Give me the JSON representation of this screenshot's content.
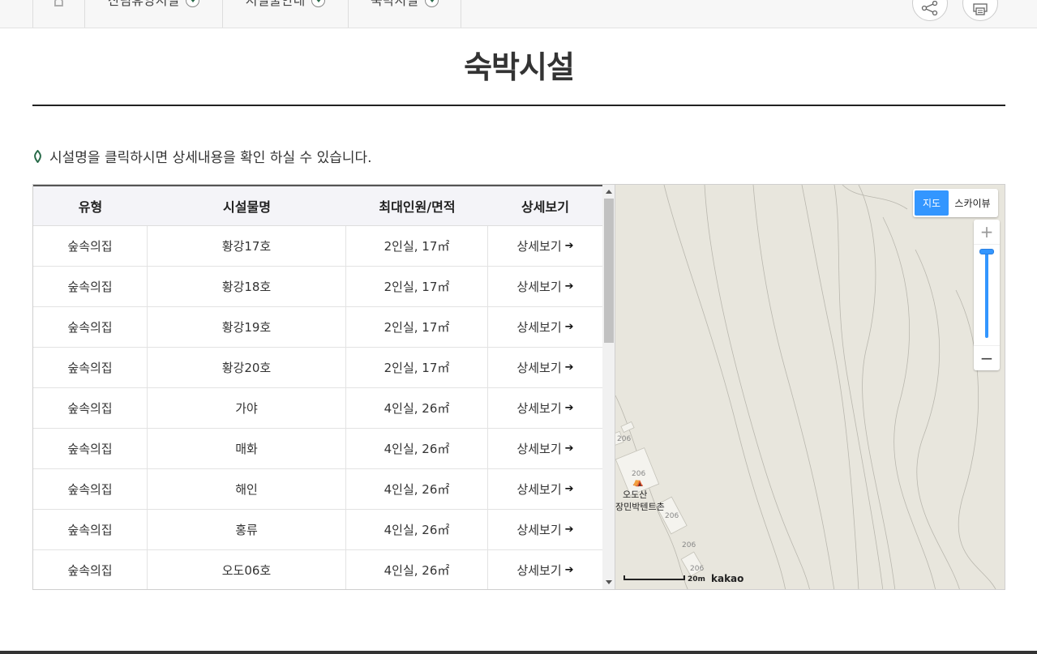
{
  "nav": {
    "items": [
      {
        "label": "산림휴양시설"
      },
      {
        "label": "시설물안내"
      },
      {
        "label": "숙박시설"
      }
    ]
  },
  "page": {
    "title": "숙박시설",
    "notice": "시설명을 클릭하시면 상세내용을 확인 하실 수 있습니다."
  },
  "table": {
    "headers": [
      "유형",
      "시설물명",
      "최대인원/면적",
      "상세보기"
    ],
    "rows": [
      {
        "type": "숲속의집",
        "name": "황강17호",
        "capacity": "2인실, 17㎡",
        "detail": "상세보기"
      },
      {
        "type": "숲속의집",
        "name": "황강18호",
        "capacity": "2인실, 17㎡",
        "detail": "상세보기"
      },
      {
        "type": "숲속의집",
        "name": "황강19호",
        "capacity": "2인실, 17㎡",
        "detail": "상세보기"
      },
      {
        "type": "숲속의집",
        "name": "황강20호",
        "capacity": "2인실, 17㎡",
        "detail": "상세보기"
      },
      {
        "type": "숲속의집",
        "name": "가야",
        "capacity": "4인실, 26㎡",
        "detail": "상세보기"
      },
      {
        "type": "숲속의집",
        "name": "매화",
        "capacity": "4인실, 26㎡",
        "detail": "상세보기"
      },
      {
        "type": "숲속의집",
        "name": "해인",
        "capacity": "4인실, 26㎡",
        "detail": "상세보기"
      },
      {
        "type": "숲속의집",
        "name": "홍류",
        "capacity": "4인실, 26㎡",
        "detail": "상세보기"
      },
      {
        "type": "숲속의집",
        "name": "오도06호",
        "capacity": "4인실, 26㎡",
        "detail": "상세보기"
      }
    ]
  },
  "map": {
    "type_map": "지도",
    "type_skyview": "스카이뷰",
    "zoom_in": "+",
    "zoom_out": "−",
    "place_line1": "오도산",
    "place_line2": "장민박텐트촌",
    "elevation_labels": [
      "206",
      "206",
      "206",
      "206",
      "206"
    ],
    "scale": "20m",
    "brand": "kakao"
  },
  "icons": {
    "home": "home-icon",
    "share": "share-icon",
    "print": "print-icon",
    "notice": "leaf-icon",
    "detail_arrow": "arrow-right-icon"
  },
  "colors": {
    "accent_green": "#2a6b4a",
    "map_active": "#3396ff",
    "map_bg": "#e8e6dd"
  }
}
